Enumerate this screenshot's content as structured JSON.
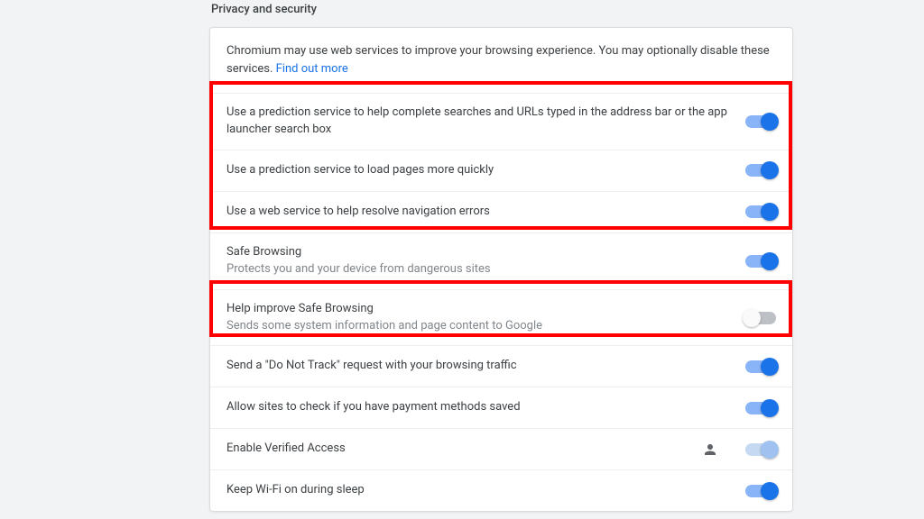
{
  "section": {
    "title": "Privacy and security"
  },
  "intro": {
    "text": "Chromium may use web services to improve your browsing experience. You may optionally disable these services. ",
    "link": "Find out more"
  },
  "rows": [
    {
      "title": "Use a prediction service to help complete searches and URLs typed in the address bar or the app launcher search box",
      "sub": "",
      "toggle": "on"
    },
    {
      "title": "Use a prediction service to load pages more quickly",
      "sub": "",
      "toggle": "on"
    },
    {
      "title": "Use a web service to help resolve navigation errors",
      "sub": "",
      "toggle": "on"
    },
    {
      "title": "Safe Browsing",
      "sub": "Protects you and your device from dangerous sites",
      "toggle": "on"
    },
    {
      "title": "Help improve Safe Browsing",
      "sub": "Sends some system information and page content to Google",
      "toggle": "off"
    },
    {
      "title": "Send a \"Do Not Track\" request with your browsing traffic",
      "sub": "",
      "toggle": "on"
    },
    {
      "title": "Allow sites to check if you have payment methods saved",
      "sub": "",
      "toggle": "on"
    },
    {
      "title": "Enable Verified Access",
      "sub": "",
      "toggle": "on-disabled",
      "personIcon": true
    },
    {
      "title": "Keep Wi-Fi on during sleep",
      "sub": "",
      "toggle": "on"
    }
  ]
}
